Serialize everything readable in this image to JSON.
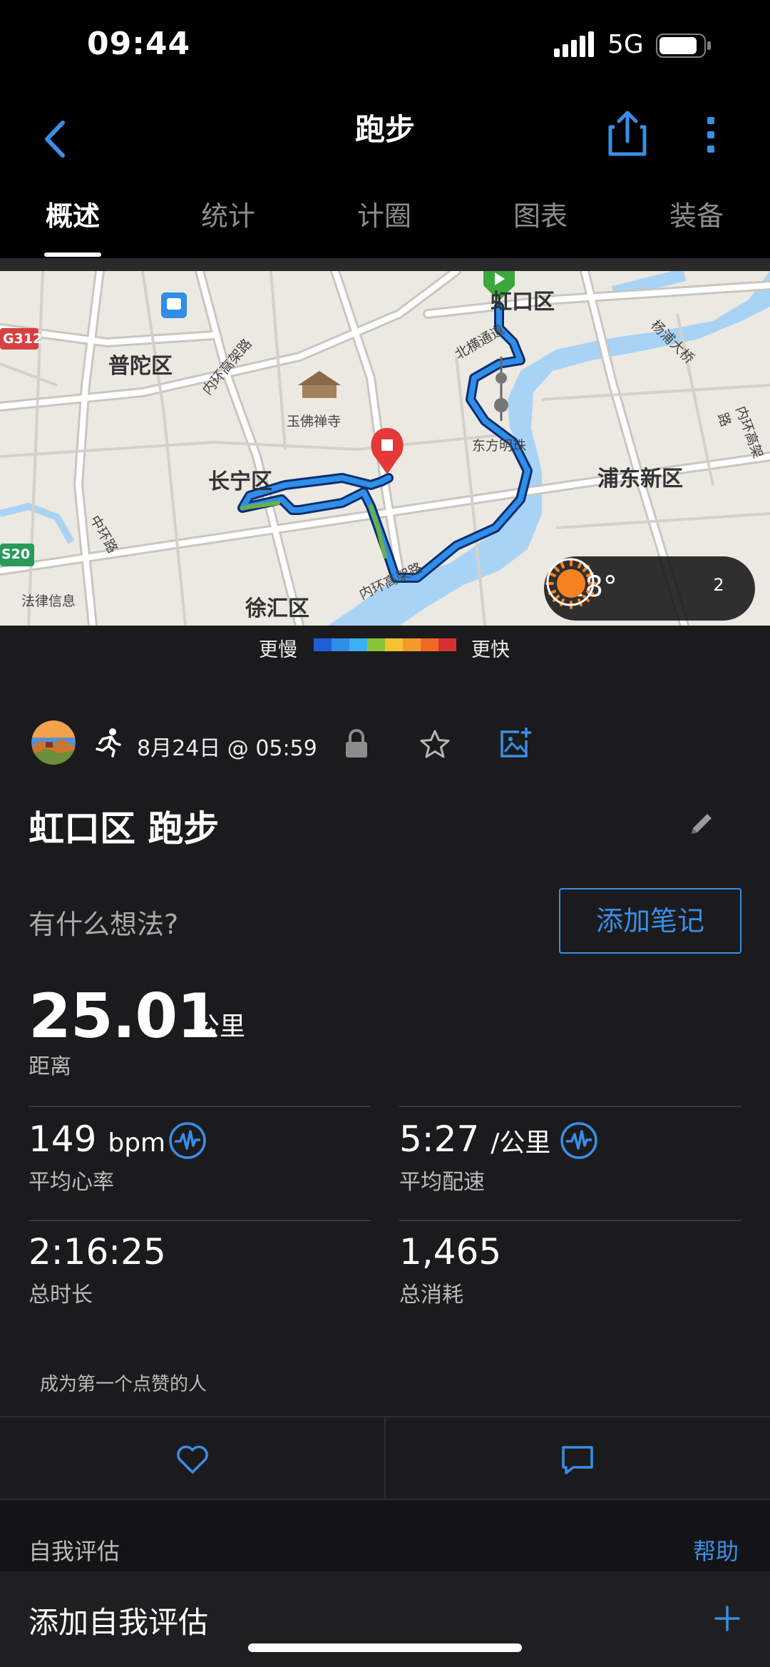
{
  "status_bar": {
    "time": "09:44",
    "network": "5G"
  },
  "nav": {
    "title": "跑步"
  },
  "tabs": [
    {
      "label": "概述",
      "active": true
    },
    {
      "label": "统计",
      "active": false
    },
    {
      "label": "计圈",
      "active": false
    },
    {
      "label": "图表",
      "active": false
    },
    {
      "label": "装备",
      "active": false
    }
  ],
  "map": {
    "labels": {
      "putuo": "普陀区",
      "changning": "长宁区",
      "xuhui": "徐汇区",
      "pudong": "浦东新区",
      "hongkou": "虹口区",
      "jade_temple": "玉佛禅寺",
      "pearl_tower": "东方明珠",
      "road_inner_ring_1": "内环高架路",
      "road_inner_ring_2": "内环高架路",
      "road_middle_ring": "中环路",
      "road_north_tunnel": "北横通道",
      "road_yangpu": "杨浦大桥",
      "road_gaojia": "内环高架路",
      "road_legal": "法律信息",
      "shield_g312": "G312",
      "shield_s20": "S20"
    },
    "weather": {
      "temperature": "28°",
      "wind_level": "2"
    }
  },
  "legend": {
    "slow": "更慢",
    "fast": "更快",
    "colors": [
      "#1f5fd6",
      "#2f8ee8",
      "#3ab0f0",
      "#8ac43a",
      "#f2c230",
      "#f59a2a",
      "#ef6a25",
      "#d83030"
    ]
  },
  "activity": {
    "date": "8月24日 @ 05:59",
    "title": "虹口区 跑步",
    "notes_prompt": "有什么想法?",
    "add_note": "添加笔记"
  },
  "stats": {
    "distance": {
      "value": "25.01",
      "unit": "公里",
      "label": "距离"
    },
    "avg_hr": {
      "value": "149",
      "unit": "bpm",
      "label": "平均心率"
    },
    "avg_pace": {
      "value": "5:27",
      "unit": "/公里",
      "label": "平均配速"
    },
    "duration": {
      "value": "2:16:25",
      "label": "总时长"
    },
    "calories": {
      "value": "1,465",
      "label": "总消耗"
    }
  },
  "social": {
    "kudos_text": "成为第一个点赞的人"
  },
  "self_eval": {
    "section_title": "自我评估",
    "help": "帮助",
    "add_label": "添加自我评估"
  },
  "colors": {
    "accent": "#3a8ee6",
    "background": "#1b1b1d"
  }
}
